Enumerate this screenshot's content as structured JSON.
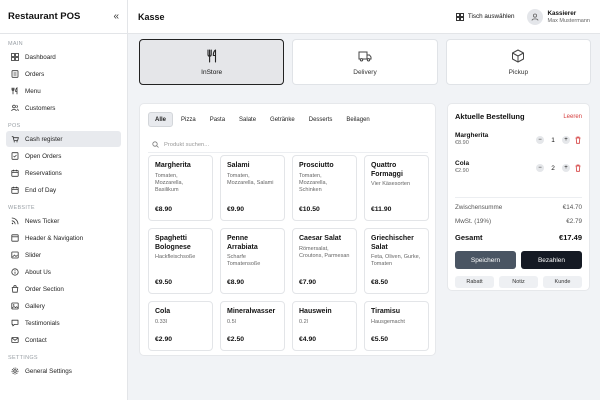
{
  "sidebar": {
    "title": "Restaurant POS",
    "collapse_icon": "«",
    "sections": [
      {
        "label": "MAIN",
        "items": [
          "Dashboard",
          "Orders",
          "Menu",
          "Customers"
        ]
      },
      {
        "label": "POS",
        "items": [
          "Cash register",
          "Open Orders",
          "Reservations",
          "End of Day"
        ]
      },
      {
        "label": "WEBSITE",
        "items": [
          "News Ticker",
          "Header & Navigation",
          "Slider",
          "About Us",
          "Order Section",
          "Gallery",
          "Testimonials",
          "Contact"
        ]
      },
      {
        "label": "SETTINGS",
        "items": [
          "General Settings"
        ]
      }
    ],
    "active_item": "Cash register"
  },
  "header": {
    "title": "Kasse",
    "table_button": "Tisch auswählen",
    "user_name": "Kassierer",
    "user_sub": "Max Mustermann"
  },
  "order_types": [
    {
      "label": "InStore",
      "icon": "cutlery-icon",
      "active": true
    },
    {
      "label": "Delivery",
      "icon": "truck-icon",
      "active": false
    },
    {
      "label": "Pickup",
      "icon": "package-icon",
      "active": false
    }
  ],
  "categories": [
    "Alle",
    "Pizza",
    "Pasta",
    "Salate",
    "Getränke",
    "Desserts",
    "Beilagen"
  ],
  "active_category": "Alle",
  "search": {
    "placeholder": "Produkt suchen..."
  },
  "products": [
    {
      "name": "Margherita",
      "desc": "Tomaten, Mozzarella, Basilikum",
      "price": "€8.90"
    },
    {
      "name": "Salami",
      "desc": "Tomaten, Mozzarella, Salami",
      "price": "€9.90"
    },
    {
      "name": "Prosciutto",
      "desc": "Tomaten, Mozzarella, Schinken",
      "price": "€10.50"
    },
    {
      "name": "Quattro Formaggi",
      "desc": "Vier Käsesorten",
      "price": "€11.90"
    },
    {
      "name": "Spaghetti Bolognese",
      "desc": "Hackfleischsoße",
      "price": "€9.50"
    },
    {
      "name": "Penne Arrabiata",
      "desc": "Scharfe Tomatensoße",
      "price": "€8.90"
    },
    {
      "name": "Caesar Salat",
      "desc": "Römersalat, Croutons, Parmesan",
      "price": "€7.90"
    },
    {
      "name": "Griechischer Salat",
      "desc": "Feta, Oliven, Gurke, Tomaten",
      "price": "€8.50"
    },
    {
      "name": "Cola",
      "desc": "0.33l",
      "price": "€2.90"
    },
    {
      "name": "Mineralwasser",
      "desc": "0.5l",
      "price": "€2.50"
    },
    {
      "name": "Hauswein",
      "desc": "0.2l",
      "price": "€4.90"
    },
    {
      "name": "Tiramisu",
      "desc": "Hausgemacht",
      "price": "€5.50"
    }
  ],
  "order": {
    "title": "Aktuelle Bestellung",
    "clear_label": "Leeren",
    "items": [
      {
        "name": "Margherita",
        "price": "€8.90",
        "qty": "1"
      },
      {
        "name": "Cola",
        "price": "€2.90",
        "qty": "2"
      }
    ],
    "subtotal_label": "Zwischensumme",
    "subtotal": "€14.70",
    "tax_label": "MwSt. (19%)",
    "tax": "€2.79",
    "total_label": "Gesamt",
    "total": "€17.49",
    "save_label": "Speichern",
    "pay_label": "Bezahlen",
    "discount_label": "Rabatt",
    "note_label": "Notiz",
    "customer_label": "Kunde"
  },
  "colors": {
    "accent_dark": "#151a24",
    "danger": "#d43c3c"
  }
}
